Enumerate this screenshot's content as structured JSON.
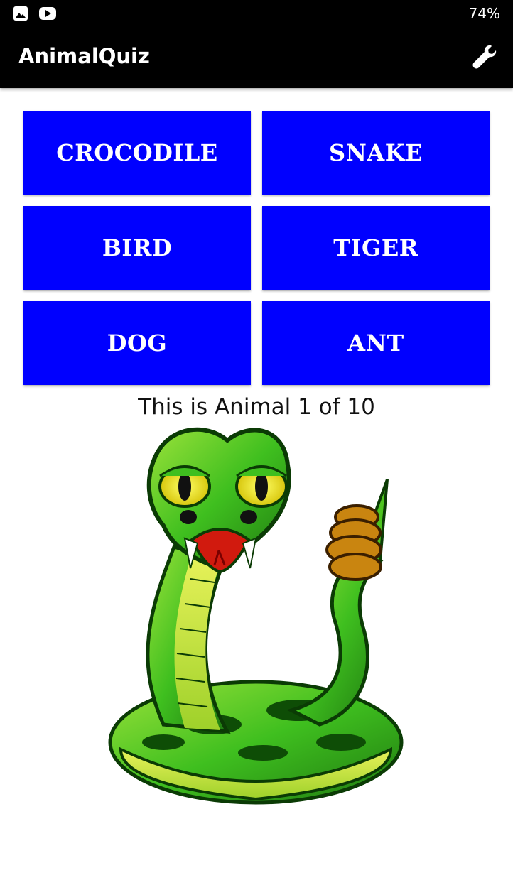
{
  "status_bar": {
    "battery": "74%",
    "icons": [
      "image-icon",
      "youtube-icon"
    ]
  },
  "app_bar": {
    "title": "AnimalQuiz",
    "settings_icon": "wrench-icon"
  },
  "answers": [
    {
      "label": "CROCODILE"
    },
    {
      "label": "SNAKE"
    },
    {
      "label": "BIRD"
    },
    {
      "label": "TIGER"
    },
    {
      "label": "DOG"
    },
    {
      "label": "ANT"
    }
  ],
  "caption": "This is Animal 1 of 10",
  "colors": {
    "button_bg": "#0000ff",
    "app_bar_bg": "#000000"
  }
}
